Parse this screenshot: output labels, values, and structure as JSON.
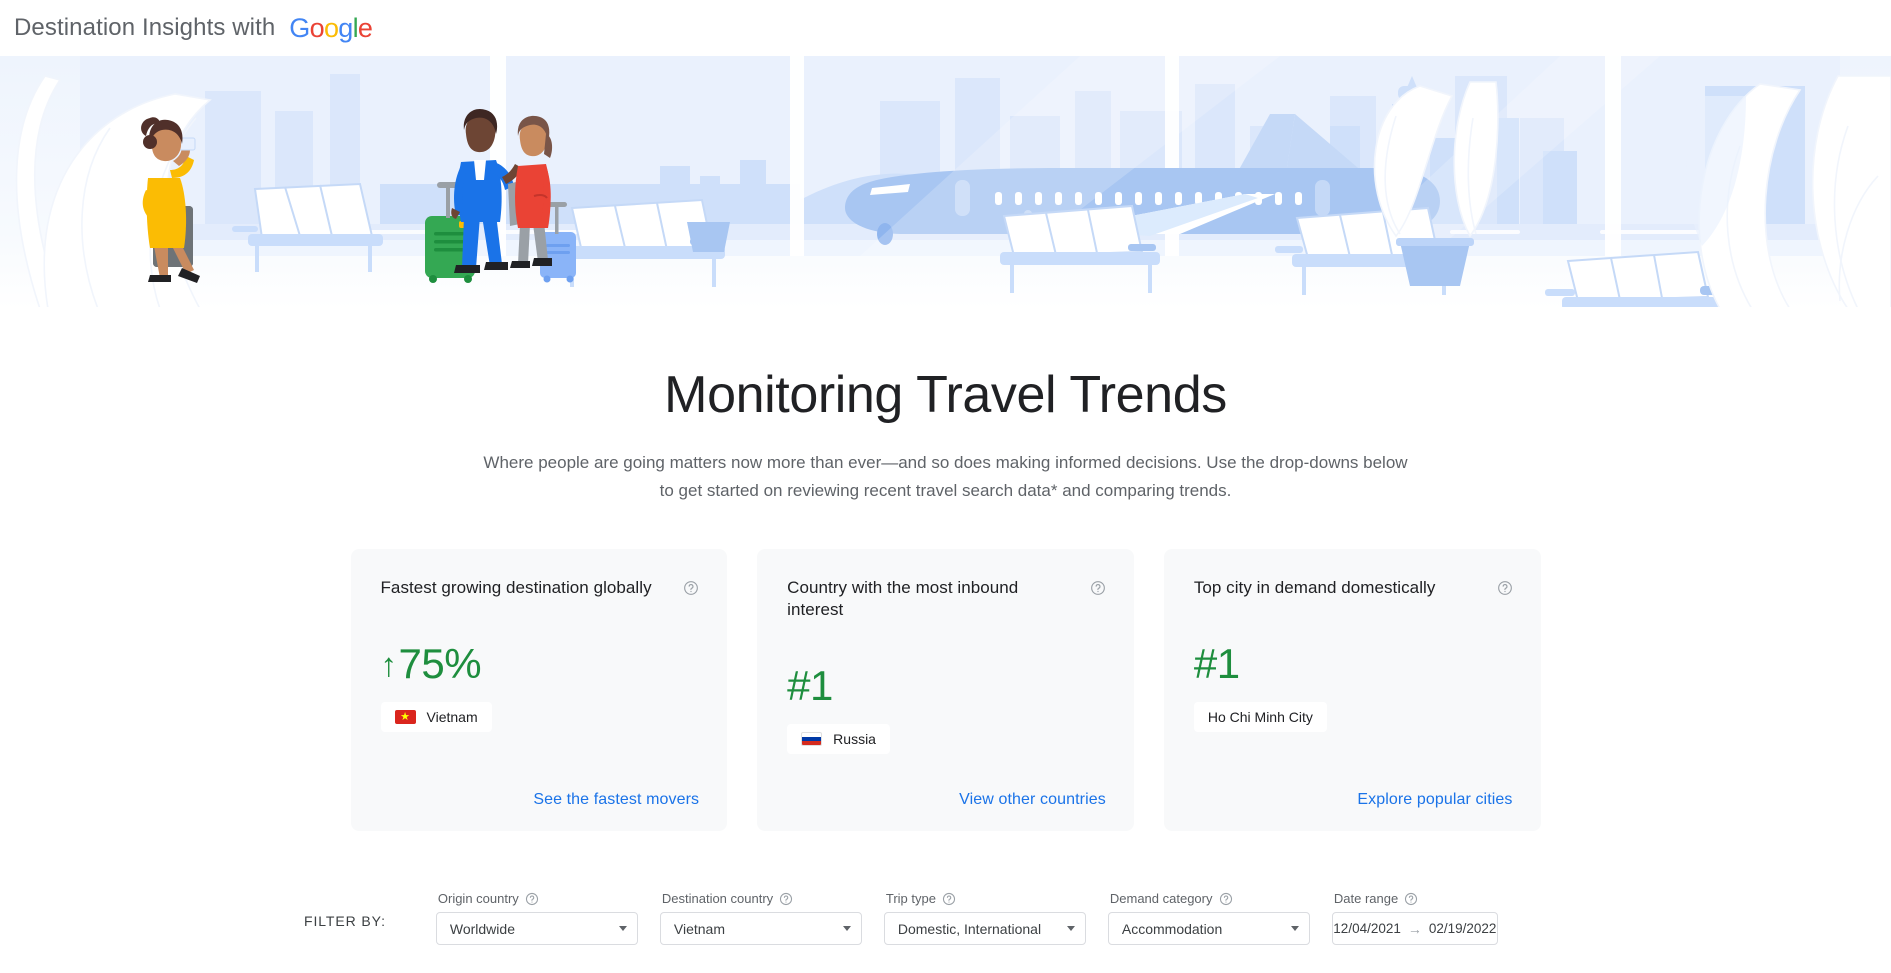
{
  "header": {
    "title": "Destination Insights with",
    "logo": {
      "name": "google-logo",
      "letters": [
        "G",
        "o",
        "o",
        "g",
        "l",
        "e"
      ]
    }
  },
  "hero": {
    "alt": "airport-terminal-illustration",
    "icon": "airport-illustration"
  },
  "main": {
    "page_title": "Monitoring Travel Trends",
    "description_line1": "Where people are going matters now more than ever—and so does making informed decisions. Use the drop-downs below",
    "description_line2": "to get started on reviewing recent travel search data* and comparing trends."
  },
  "cards": [
    {
      "title": "Fastest growing destination globally",
      "help_icon": "help-circle-icon",
      "arrow": "↑",
      "metric": "75%",
      "chip_label": "Vietnam",
      "chip_flag": "flag-vietnam",
      "link": "See the fastest movers",
      "metric_color": "#1e8e3e"
    },
    {
      "title": "Country with the most inbound interest",
      "help_icon": "help-circle-icon",
      "arrow": "",
      "metric": "#1",
      "chip_label": "Russia",
      "chip_flag": "flag-russia",
      "link": "View other countries",
      "metric_color": "#1e8e3e"
    },
    {
      "title": "Top city in demand domestically",
      "help_icon": "help-circle-icon",
      "arrow": "",
      "metric": "#1",
      "chip_label": "Ho Chi Minh City",
      "chip_flag": "",
      "link": "Explore popular cities",
      "metric_color": "#1e8e3e"
    }
  ],
  "filters": {
    "label": "FILTER BY:",
    "items": [
      {
        "label": "Origin country",
        "value": "Worldwide",
        "help_icon": "help-circle-icon"
      },
      {
        "label": "Destination country",
        "value": "Vietnam",
        "help_icon": "help-circle-icon"
      },
      {
        "label": "Trip type",
        "value": "Domestic, International",
        "help_icon": "help-circle-icon"
      },
      {
        "label": "Demand category",
        "value": "Accommodation",
        "help_icon": "help-circle-icon"
      }
    ],
    "date_range": {
      "label": "Date range",
      "help_icon": "help-circle-icon",
      "start": "12/04/2021",
      "arrow": "→",
      "end": "02/19/2022"
    }
  },
  "colors": {
    "accent_blue": "#1a73e8",
    "green": "#1e8e3e",
    "card_bg": "#f8f9fa",
    "text_primary": "#202124",
    "text_secondary": "#5f6368"
  }
}
